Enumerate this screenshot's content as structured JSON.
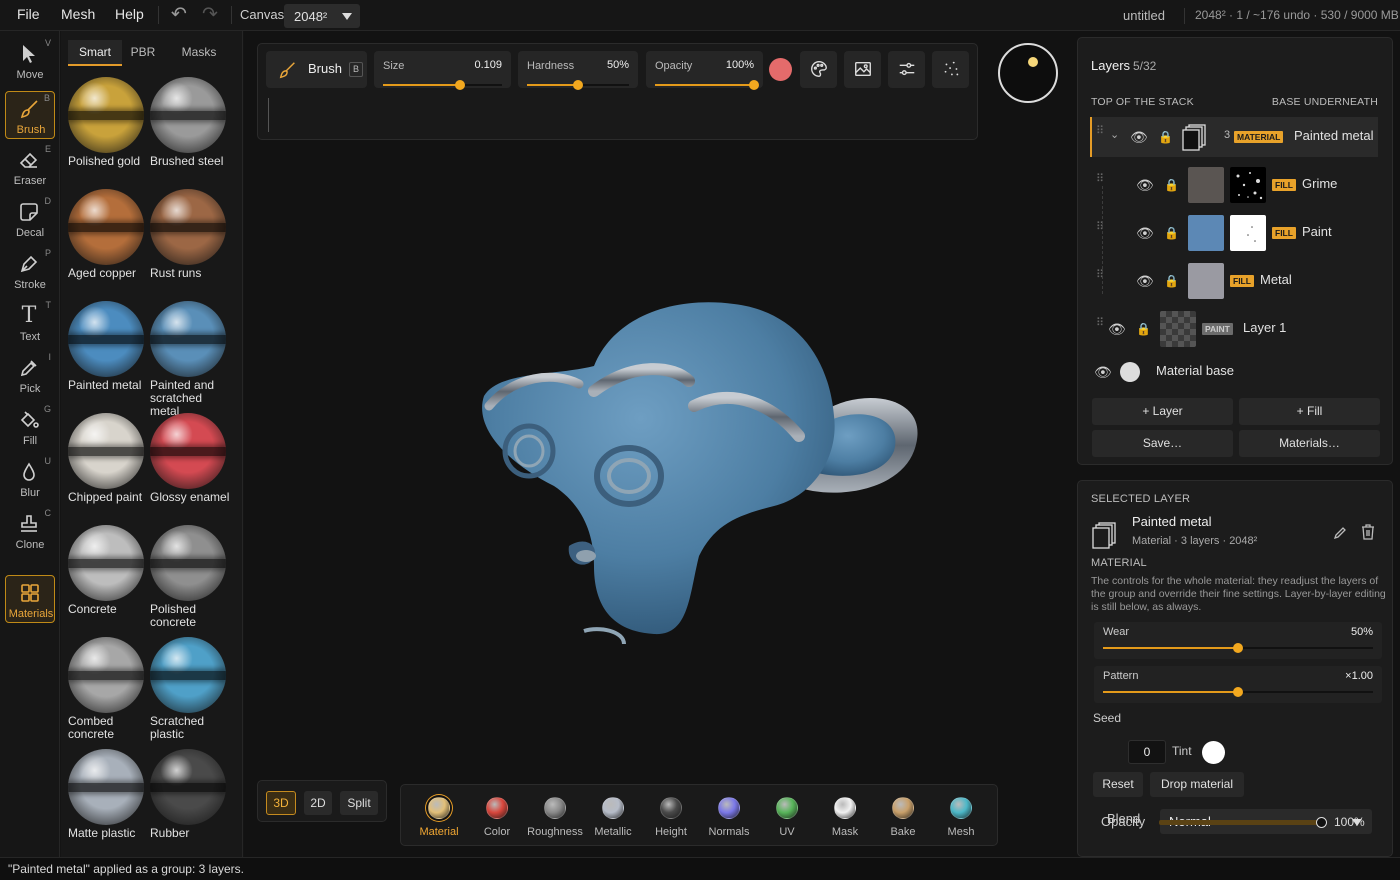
{
  "menu": {
    "file": "File",
    "mesh": "Mesh",
    "help": "Help"
  },
  "toolbar": {
    "undo_icon": "undo-icon",
    "redo_icon": "redo-icon",
    "canvas_label": "Canvas",
    "canvas_value": "2048²"
  },
  "document": {
    "name": "untitled",
    "stats": "2048² · 1 / ~176 undo · 530 / 9000 MB"
  },
  "tools": [
    {
      "label": "Move",
      "key": "V",
      "icon": "cursor-icon"
    },
    {
      "label": "Brush",
      "key": "B",
      "icon": "brush-icon",
      "selected": true
    },
    {
      "label": "Eraser",
      "key": "E",
      "icon": "eraser-icon"
    },
    {
      "label": "Decal",
      "key": "D",
      "icon": "sticker-icon"
    },
    {
      "label": "Stroke",
      "key": "P",
      "icon": "pen-icon"
    },
    {
      "label": "Text",
      "key": "T",
      "icon": "text-icon"
    },
    {
      "label": "Pick",
      "key": "I",
      "icon": "eyedropper-icon"
    },
    {
      "label": "Fill",
      "key": "G",
      "icon": "bucket-icon"
    },
    {
      "label": "Blur",
      "key": "U",
      "icon": "drop-icon"
    },
    {
      "label": "Clone",
      "key": "C",
      "icon": "stamp-icon"
    },
    {
      "label": "Materials",
      "key": "",
      "icon": "grid-icon",
      "selected": true
    }
  ],
  "library": {
    "tabs": [
      "Smart",
      "PBR",
      "Masks"
    ],
    "active_tab": "Smart",
    "materials": [
      {
        "name": "Polished gold",
        "color": "#c9a23b"
      },
      {
        "name": "Brushed steel",
        "color": "#9a9a9a"
      },
      {
        "name": "Aged copper",
        "color": "#b46e3b"
      },
      {
        "name": "Rust runs",
        "color": "#9c6745"
      },
      {
        "name": "Painted metal",
        "color": "#4c8cbf"
      },
      {
        "name": "Painted and scratched metal",
        "color": "#5a8fb8"
      },
      {
        "name": "Chipped paint",
        "color": "#d8d4cc"
      },
      {
        "name": "Glossy enamel",
        "color": "#d44a52"
      },
      {
        "name": "Concrete",
        "color": "#bdbdbd"
      },
      {
        "name": "Polished concrete",
        "color": "#8f8f8f"
      },
      {
        "name": "Combed concrete",
        "color": "#a7a7a7"
      },
      {
        "name": "Scratched plastic",
        "color": "#4fa0c8"
      },
      {
        "name": "Matte plastic",
        "color": "#a8b0ba"
      },
      {
        "name": "Rubber",
        "color": "#4a4a4a"
      }
    ]
  },
  "brush": {
    "label": "Brush",
    "key": "B",
    "size_label": "Size",
    "size_value": "0.109",
    "size_fraction": 0.65,
    "hardness_label": "Hardness",
    "hardness_value": "50%",
    "hardness_fraction": 0.5,
    "opacity_label": "Opacity",
    "opacity_value": "100%",
    "opacity_fraction": 1.0,
    "color": "#e46b6b",
    "icons": [
      "palette-icon",
      "image-icon",
      "sliders-icon",
      "scatter-icon"
    ]
  },
  "view_modes": {
    "options": [
      "3D",
      "2D",
      "Split"
    ],
    "selected": "3D"
  },
  "channels": [
    {
      "label": "Material",
      "color": "#e3c079",
      "selected": true
    },
    {
      "label": "Color",
      "color": "#d9473d"
    },
    {
      "label": "Roughness",
      "color": "#8a8a8a"
    },
    {
      "label": "Metallic",
      "color": "#b6bcc8"
    },
    {
      "label": "Height",
      "color": "#4a4a4a"
    },
    {
      "label": "Normals",
      "color": "#7b78e8"
    },
    {
      "label": "UV",
      "color": "#58b45a"
    },
    {
      "label": "Mask",
      "color": "#f2f2f2"
    },
    {
      "label": "Bake",
      "color": "#c9a06a"
    },
    {
      "label": "Mesh",
      "color": "#4cb8c8"
    }
  ],
  "layers": {
    "title": "Layers",
    "count": "5/32",
    "top_label": "TOP OF THE STACK",
    "bottom_label": "BASE UNDERNEATH",
    "group": {
      "count": "3",
      "badge": "MATERIAL",
      "name": "Painted metal"
    },
    "children": [
      {
        "badge": "FILL",
        "name": "Grime",
        "swatch": "#5a5552"
      },
      {
        "badge": "FILL",
        "name": "Paint",
        "swatch": "#5c88b5"
      },
      {
        "badge": "FILL",
        "name": "Metal",
        "swatch": "#9a9aa2"
      }
    ],
    "paint_layer": {
      "badge": "PAINT",
      "name": "Layer 1"
    },
    "base": {
      "name": "Material base"
    },
    "buttons": {
      "add_layer": "+ Layer",
      "add_fill": "+ Fill",
      "save": "Save…",
      "materials": "Materials…"
    }
  },
  "selected_layer": {
    "section": "SELECTED LAYER",
    "name": "Painted metal",
    "meta": "Material · 3 layers · 2048²",
    "material_header": "MATERIAL",
    "description": "The controls for the whole material: they readjust the layers of the group and override their fine settings. Layer-by-layer editing is still below, as always.",
    "wear_label": "Wear",
    "wear_value": "50%",
    "wear_fraction": 0.5,
    "pattern_label": "Pattern",
    "pattern_value": "×1.00",
    "pattern_fraction": 0.5,
    "seed_label": "Seed",
    "seed_value": "0",
    "tint_label": "Tint",
    "tint_color": "#ffffff",
    "reset_label": "Reset",
    "drop_label": "Drop material",
    "blend_label": "Blend",
    "blend_value": "Normal",
    "opacity_label": "Opacity",
    "opacity_value": "100%",
    "opacity_fraction": 1.0
  },
  "status": "\"Painted metal\" applied as a group: 3 layers."
}
